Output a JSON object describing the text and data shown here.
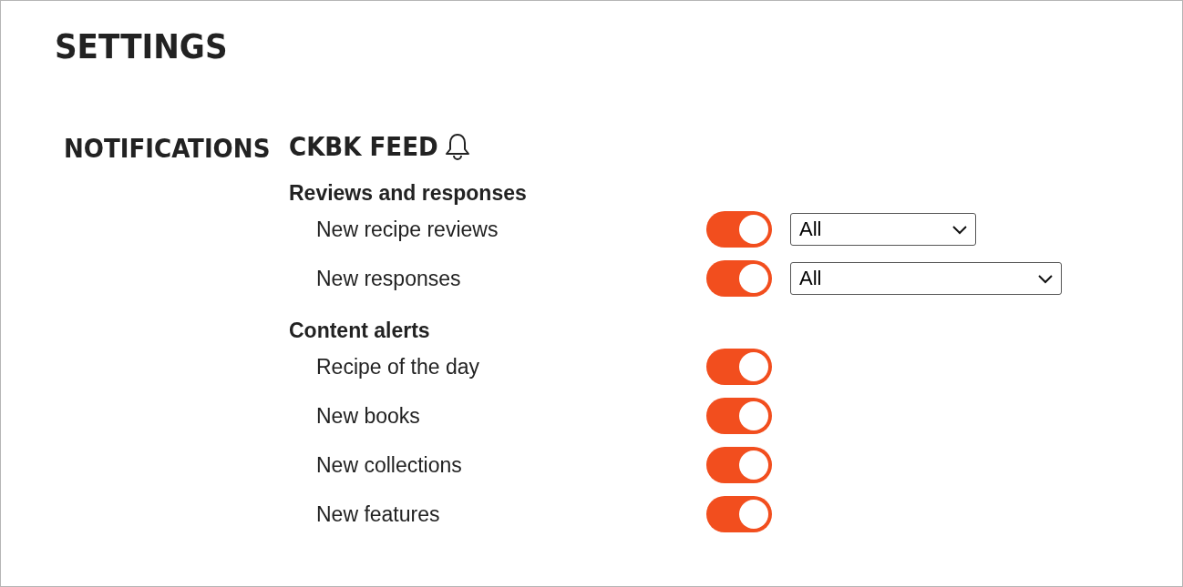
{
  "title": "SETTINGS",
  "section_label": "NOTIFICATIONS",
  "feed": {
    "title": "CKBK FEED",
    "groups": [
      {
        "heading": "Reviews and responses",
        "items": [
          {
            "label": "New recipe reviews",
            "on": true,
            "select": {
              "value": "All"
            }
          },
          {
            "label": "New responses",
            "on": true,
            "select": {
              "value": "All"
            }
          }
        ]
      },
      {
        "heading": "Content alerts",
        "items": [
          {
            "label": "Recipe of the day",
            "on": true
          },
          {
            "label": "New books",
            "on": true
          },
          {
            "label": "New collections",
            "on": true
          },
          {
            "label": "New features",
            "on": true
          }
        ]
      }
    ]
  }
}
